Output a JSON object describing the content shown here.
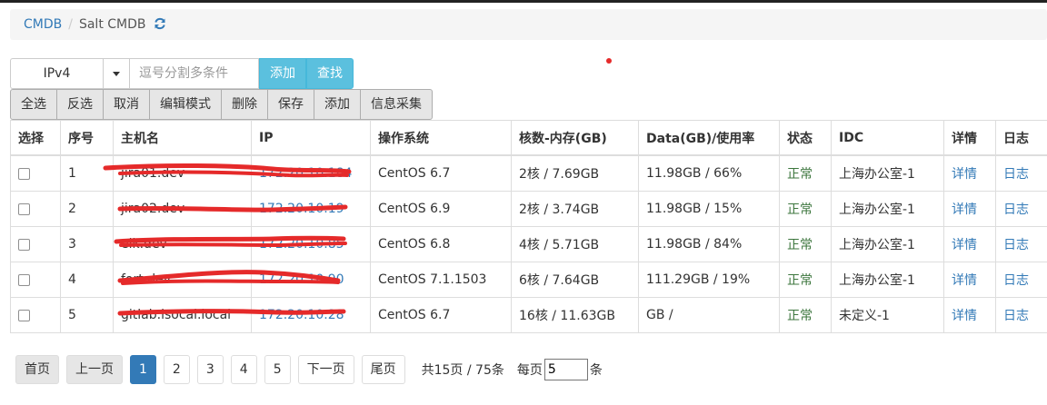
{
  "breadcrumb": {
    "root": "CMDB",
    "current": "Salt CMDB"
  },
  "search": {
    "select_value": "IPv4",
    "placeholder": "逗号分割多条件",
    "add_label": "添加",
    "find_label": "查找"
  },
  "toolbar": [
    "全选",
    "反选",
    "取消",
    "编辑模式",
    "删除",
    "保存",
    "添加",
    "信息采集"
  ],
  "table": {
    "headers": [
      "选择",
      "序号",
      "主机名",
      "IP",
      "操作系统",
      "核数-内存(GB)",
      "Data(GB)/使用率",
      "状态",
      "IDC",
      "详情",
      "日志"
    ],
    "rows": [
      {
        "id": "1",
        "host": "jira01.dev",
        "ip": "172.20.10.184",
        "os": "CentOS 6.7",
        "cpu_mem": "2核 / 7.69GB",
        "data": "11.98GB / 66%",
        "status": "正常",
        "idc": "上海办公室-1",
        "detail": "详情",
        "log": "日志"
      },
      {
        "id": "2",
        "host": "jira02.dev",
        "ip": "172.20.10.19",
        "os": "CentOS 6.9",
        "cpu_mem": "2核 / 3.74GB",
        "data": "11.98GB / 15%",
        "status": "正常",
        "idc": "上海办公室-1",
        "detail": "详情",
        "log": "日志"
      },
      {
        "id": "3",
        "host": "elk.dev",
        "ip": "172.20.10.85",
        "os": "CentOS 6.8",
        "cpu_mem": "4核 / 5.71GB",
        "data": "11.98GB / 84%",
        "status": "正常",
        "idc": "上海办公室-1",
        "detail": "详情",
        "log": "日志"
      },
      {
        "id": "4",
        "host": "fort.dev",
        "ip": "172.20.10.90",
        "os": "CentOS 7.1.1503",
        "cpu_mem": "6核 / 7.64GB",
        "data": "111.29GB / 19%",
        "status": "正常",
        "idc": "上海办公室-1",
        "detail": "详情",
        "log": "日志"
      },
      {
        "id": "5",
        "host": "gitlab.isocal.local",
        "ip": "172.20.10.28",
        "os": "CentOS 6.7",
        "cpu_mem": "16核 / 11.63GB",
        "data": "GB /",
        "status": "正常",
        "idc": "未定义-1",
        "detail": "详情",
        "log": "日志"
      }
    ]
  },
  "pagination": {
    "first": "首页",
    "prev": "上一页",
    "pages": [
      "1",
      "2",
      "3",
      "4",
      "5"
    ],
    "next": "下一页",
    "last": "尾页",
    "summary": "共15页 / 75条",
    "per_page_label": "每页",
    "per_page_value": "5",
    "per_page_unit": "条"
  },
  "colors": {
    "link": "#337ab7",
    "status_ok": "#3c763d",
    "info_button": "#5bc0de",
    "scribble": "#e52a2a"
  }
}
